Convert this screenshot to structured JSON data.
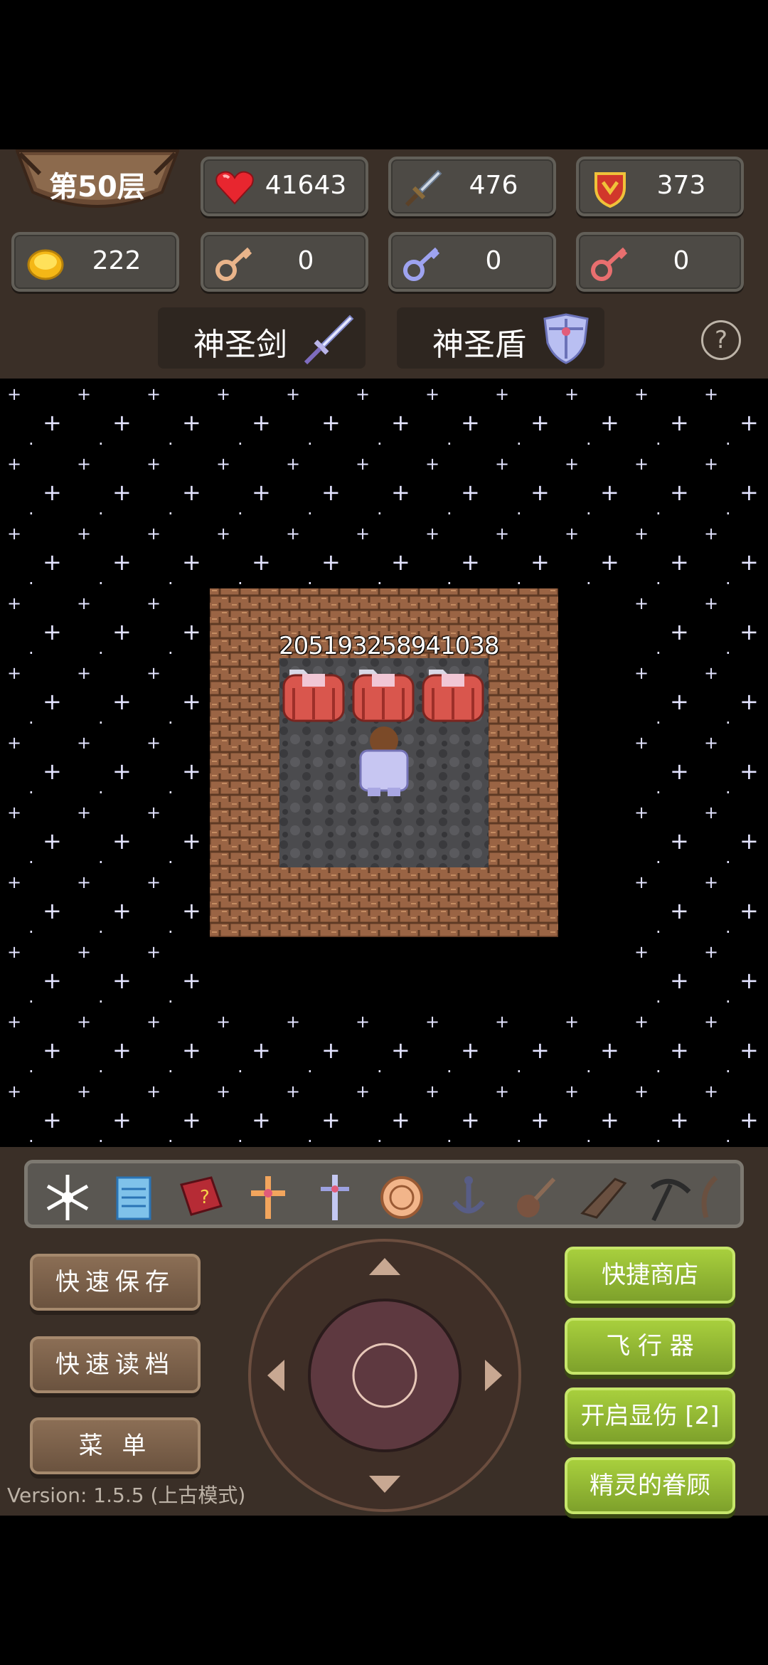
{
  "header": {
    "floor_label": "第50层",
    "stats": {
      "hp": "41643",
      "attack": "476",
      "defense": "373",
      "gold": "222",
      "yellow_keys": "0",
      "blue_keys": "0",
      "red_keys": "0"
    },
    "equipment": {
      "weapon": "神圣剑",
      "shield": "神圣盾"
    },
    "help_label": "?"
  },
  "field": {
    "damage_labels": [
      "20519",
      "32589",
      "41038"
    ],
    "enemy_name_hint": "",
    "colors": {
      "wall": "#8b5a3c",
      "floor": "#4a4a4a",
      "star": "#e3e3ff"
    }
  },
  "toolbar": {
    "items": [
      "snowflake-icon",
      "notepad-icon",
      "monster-book-icon",
      "holy-cross-icon",
      "dagger-cross-icon",
      "coin-medal-icon",
      "anchor-icon",
      "guitar-icon",
      "wing-icon",
      "pickaxe-icon",
      "extra-tool-icon"
    ]
  },
  "buttons": {
    "quick_save": "快速保存",
    "quick_load": "快速读档",
    "menu": "菜 单",
    "quick_shop": "快捷商店",
    "flyer": "飞 行 器",
    "show_damage": "开启显伤 [2]",
    "fairy_favor": "精灵的眷顾"
  },
  "version": "Version: 1.5.5 (上古模式)",
  "colors": {
    "panel_bg": "#3a2f27",
    "green_button": "#9ac23a",
    "brown_button": "#7b624b"
  }
}
